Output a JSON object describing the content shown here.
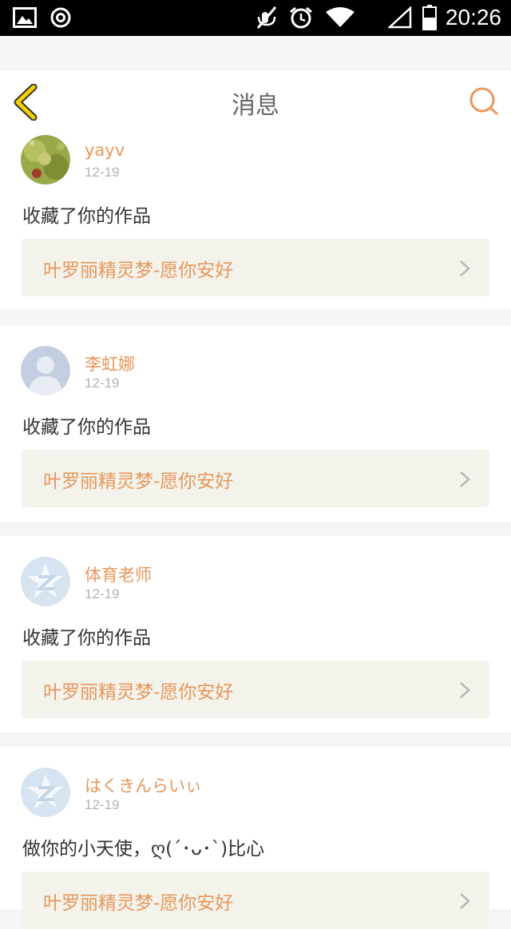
{
  "status_bar": {
    "time": "20:26",
    "icons": [
      "image-icon",
      "target-icon",
      "mute-icon",
      "alarm-icon",
      "wifi-icon",
      "signal-icon",
      "battery-icon"
    ]
  },
  "header": {
    "title": "消息",
    "back_icon": "chevron-left-icon",
    "search_icon": "search-icon"
  },
  "colors": {
    "accent": "#e8965a",
    "back_yellow": "#f5d000",
    "card_bg": "#ffffff",
    "work_bg": "#f3f3ec"
  },
  "messages": [
    {
      "user": "yayv",
      "date": "12-19",
      "text": "收藏了你的作品",
      "work": "叶罗丽精灵梦-愿你安好",
      "avatar": "photo-avatar"
    },
    {
      "user": "李虹娜",
      "date": "12-19",
      "text": "收藏了你的作品",
      "work": "叶罗丽精灵梦-愿你安好",
      "avatar": "default-person-avatar"
    },
    {
      "user": "体育老师",
      "date": "12-19",
      "text": "收藏了你的作品",
      "work": "叶罗丽精灵梦-愿你安好",
      "avatar": "qzone-avatar"
    },
    {
      "user": "はくきんらいぃ",
      "date": "12-19",
      "text": "做你的小天使，ღ(´･ᴗ･`)比心",
      "work": "叶罗丽精灵梦-愿你安好",
      "avatar": "qzone-avatar"
    }
  ]
}
